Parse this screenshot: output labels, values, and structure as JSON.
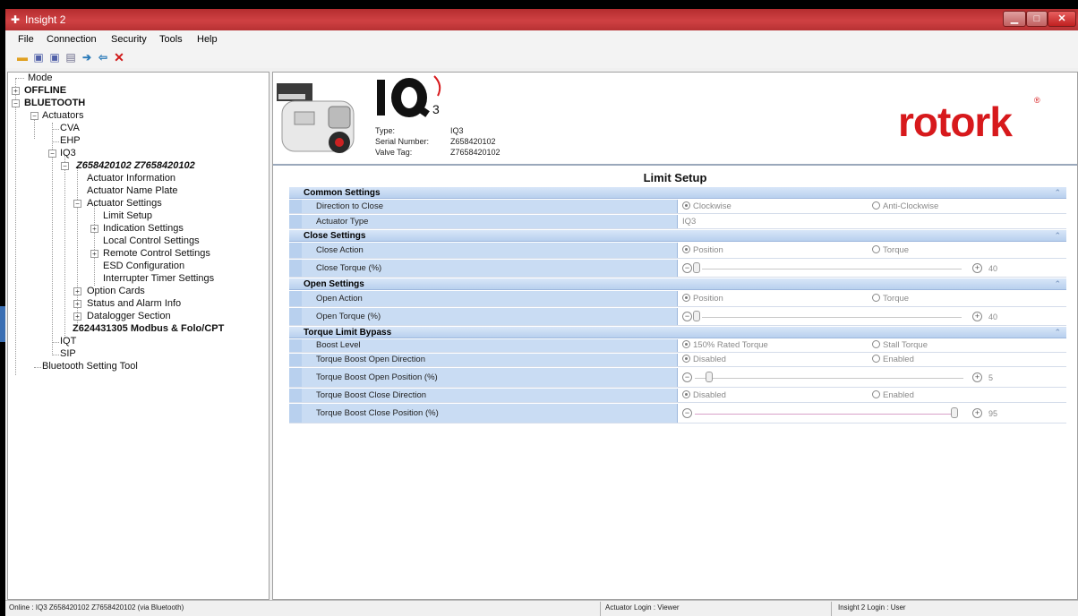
{
  "window": {
    "title": "Insight 2"
  },
  "menu": [
    "File",
    "Connection",
    "Security",
    "Tools",
    "Help"
  ],
  "toolbar_icons": [
    "open-folder-icon",
    "save-icon",
    "save-as-icon",
    "print-icon",
    "arrow-right-icon",
    "arrow-left-icon",
    "delete-x-icon"
  ],
  "tree": {
    "mode": "Mode",
    "offline": "OFFLINE",
    "bluetooth": "BLUETOOTH",
    "actuators": "Actuators",
    "cva": "CVA",
    "ehp": "EHP",
    "iq3": "IQ3",
    "device": "Z658420102 Z7658420102",
    "actuator_info": "Actuator Information",
    "name_plate": "Actuator Name Plate",
    "actuator_settings": "Actuator Settings",
    "limit_setup": "Limit Setup",
    "indication_settings": "Indication Settings",
    "local_control": "Local Control Settings",
    "remote_control": "Remote Control Settings",
    "esd": "ESD Configuration",
    "interrupter": "Interrupter Timer Settings",
    "option_cards": "Option Cards",
    "status_alarm": "Status and Alarm Info",
    "datalogger": "Datalogger Section",
    "device2": "Z624431305 Modbus & Folo/CPT",
    "iqt": "IQT",
    "sip": "SIP",
    "bt_tool": "Bluetooth Setting Tool"
  },
  "header": {
    "logo_text": "IQ",
    "logo_sub": "3",
    "type_label": "Type:",
    "type_value": "IQ3",
    "serial_label": "Serial Number:",
    "serial_value": "Z658420102",
    "tag_label": "Valve Tag:",
    "tag_value": "Z7658420102",
    "brand": "rotork",
    "brand_mark": "®"
  },
  "page_title": "Limit Setup",
  "grid": {
    "common": {
      "title": "Common Settings",
      "direction_label": "Direction to Close",
      "direction_opt1": "Clockwise",
      "direction_opt2": "Anti-Clockwise",
      "type_label": "Actuator Type",
      "type_value": "IQ3"
    },
    "close": {
      "title": "Close Settings",
      "action_label": "Close Action",
      "action_opt1": "Position",
      "action_opt2": "Torque",
      "torque_label": "Close Torque (%)",
      "torque_value": "40"
    },
    "open": {
      "title": "Open Settings",
      "action_label": "Open Action",
      "action_opt1": "Position",
      "action_opt2": "Torque",
      "torque_label": "Open Torque (%)",
      "torque_value": "40"
    },
    "bypass": {
      "title": "Torque Limit Bypass",
      "boost_label": "Boost Level",
      "boost_opt1": "150% Rated Torque",
      "boost_opt2": "Stall Torque",
      "open_dir_label": "Torque Boost Open Direction",
      "open_dir_opt1": "Disabled",
      "open_dir_opt2": "Enabled",
      "open_pos_label": "Torque Boost Open Position (%)",
      "open_pos_value": "5",
      "close_dir_label": "Torque Boost Close Direction",
      "close_dir_opt1": "Disabled",
      "close_dir_opt2": "Enabled",
      "close_pos_label": "Torque Boost Close Position (%)",
      "close_pos_value": "95"
    }
  },
  "status": {
    "left": "Online : IQ3 Z658420102 Z7658420102 (via Bluetooth)",
    "middle": "Actuator Login : Viewer",
    "right": "Insight 2 Login : User"
  },
  "colors": {
    "title_bar": "#c93a3c",
    "brand": "#d7191c",
    "category": "#b8d0ee",
    "label_cell": "#c9dcf3"
  }
}
